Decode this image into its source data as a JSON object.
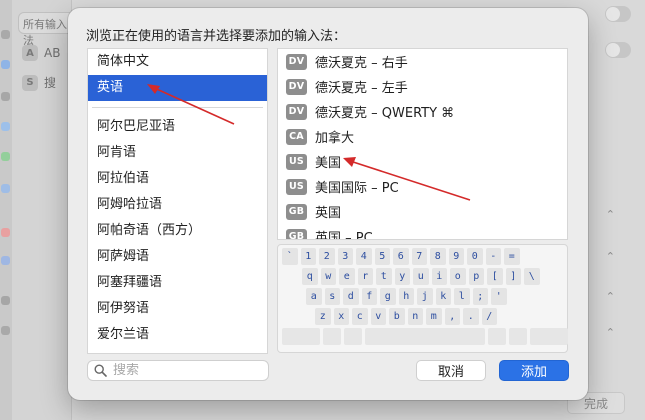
{
  "background": {
    "sidebar_title": "所有输入法",
    "rows": [
      {
        "badge": "A",
        "label": "AB"
      },
      {
        "badge": "S",
        "label": "搜"
      }
    ],
    "done_label": "完成"
  },
  "dialog": {
    "title": "浏览正在使用的语言并选择要添加的输入法：",
    "languages": [
      {
        "label": "简体中文",
        "selected": false
      },
      {
        "label": "英语",
        "selected": true
      },
      {
        "label": "阿尔巴尼亚语",
        "selected": false
      },
      {
        "label": "阿肯语",
        "selected": false
      },
      {
        "label": "阿拉伯语",
        "selected": false
      },
      {
        "label": "阿姆哈拉语",
        "selected": false
      },
      {
        "label": "阿帕奇语（西方）",
        "selected": false
      },
      {
        "label": "阿萨姆语",
        "selected": false
      },
      {
        "label": "阿塞拜疆语",
        "selected": false
      },
      {
        "label": "阿伊努语",
        "selected": false
      },
      {
        "label": "爱尔兰语",
        "selected": false
      }
    ],
    "input_sources": [
      {
        "code": "DV",
        "label": "德沃夏克 – 右手"
      },
      {
        "code": "DV",
        "label": "德沃夏克 – 左手"
      },
      {
        "code": "DV",
        "label": "德沃夏克 – QWERTY ⌘"
      },
      {
        "code": "CA",
        "label": "加拿大"
      },
      {
        "code": "US",
        "label": "美国"
      },
      {
        "code": "US",
        "label": "美国国际 – PC"
      },
      {
        "code": "GB",
        "label": "英国"
      },
      {
        "code": "GB",
        "label": "英国 – PC"
      }
    ],
    "keyboard_rows": [
      [
        "`",
        "1",
        "2",
        "3",
        "4",
        "5",
        "6",
        "7",
        "8",
        "9",
        "0",
        "-",
        "="
      ],
      [
        "q",
        "w",
        "e",
        "r",
        "t",
        "y",
        "u",
        "i",
        "o",
        "p",
        "[",
        "]",
        "\\"
      ],
      [
        "a",
        "s",
        "d",
        "f",
        "g",
        "h",
        "j",
        "k",
        "l",
        ";",
        "'"
      ],
      [
        "z",
        "x",
        "c",
        "v",
        "b",
        "n",
        "m",
        ",",
        ".",
        "/"
      ]
    ],
    "search_placeholder": "搜索",
    "cancel_label": "取消",
    "add_label": "添加"
  },
  "colors": {
    "selection": "#2a62d6",
    "primary_button": "#2b72e6",
    "annotation_arrow": "#d42a2a"
  }
}
